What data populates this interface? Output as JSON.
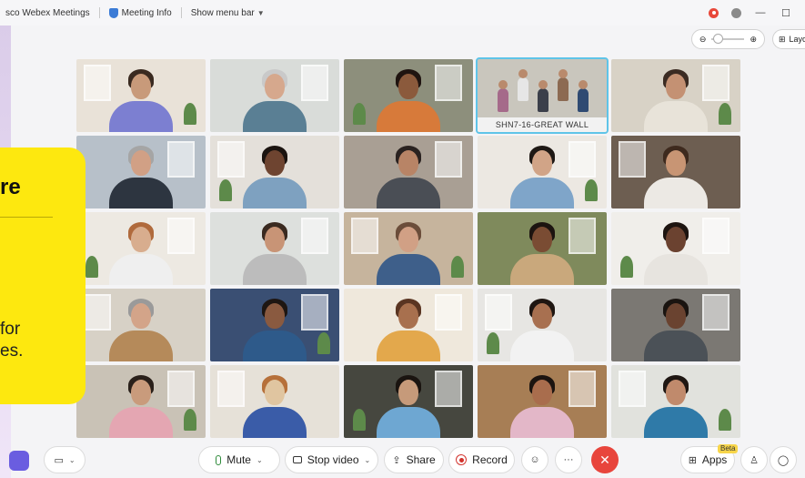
{
  "titlebar": {
    "app_title": "sco Webex Meetings",
    "meeting_info": "Meeting Info",
    "show_menu_bar": "Show menu bar"
  },
  "view": {
    "layout_label": "Layo"
  },
  "grid": {
    "tiles": [
      {
        "wall": "#e9e2d8",
        "skin": "#c89a7a",
        "hair": "#3a2a20",
        "shirt": "#7c7fd1"
      },
      {
        "wall": "#d9dcd9",
        "skin": "#d6a88d",
        "hair": "#c9c9c9",
        "shirt": "#5a7f94"
      },
      {
        "wall": "#8d8f7c",
        "skin": "#8b5a3c",
        "hair": "#1f1410",
        "shirt": "#d77a3a"
      },
      {
        "wall": "#c9c6bd",
        "room": true,
        "label": "SHN7-16-GREAT WALL"
      },
      {
        "wall": "#d8d2c6",
        "skin": "#c49173",
        "hair": "#3b2b22",
        "shirt": "#e8e3d9"
      },
      {
        "wall": "#b7c0c9",
        "skin": "#d1a085",
        "hair": "#a5a5a5",
        "shirt": "#2d3540"
      },
      {
        "wall": "#e4e0da",
        "skin": "#6e4430",
        "hair": "#1b1410",
        "shirt": "#7ea1c0"
      },
      {
        "wall": "#a99f94",
        "skin": "#b88466",
        "hair": "#2a2220",
        "shirt": "#4a4e55"
      },
      {
        "wall": "#ece8e2",
        "skin": "#d1a487",
        "hair": "#1e1814",
        "shirt": "#7fa5c9"
      },
      {
        "wall": "#6d5e51",
        "skin": "#c89574",
        "hair": "#3e2a1e",
        "shirt": "#ece9e4"
      },
      {
        "wall": "#ede9e2",
        "skin": "#d8ad8e",
        "hair": "#b06a3c",
        "shirt": "#efefef"
      },
      {
        "wall": "#dde0dd",
        "skin": "#c89476",
        "hair": "#3a2a20",
        "shirt": "#bcbcbc"
      },
      {
        "wall": "#c6b49d",
        "skin": "#d1a085",
        "hair": "#6b4d3a",
        "shirt": "#3e5f8a"
      },
      {
        "wall": "#7f8a5c",
        "skin": "#7a4c33",
        "hair": "#1c1410",
        "shirt": "#c9a87c"
      },
      {
        "wall": "#f0eeea",
        "skin": "#6b4230",
        "hair": "#1d1410",
        "shirt": "#e7e4df"
      },
      {
        "wall": "#d7d1c6",
        "skin": "#d3a489",
        "hair": "#9a9a9a",
        "shirt": "#b58a5a"
      },
      {
        "wall": "#3a4f73",
        "skin": "#8a5a40",
        "hair": "#1e1612",
        "shirt": "#2e5a8a"
      },
      {
        "wall": "#efe8dc",
        "skin": "#a8704e",
        "hair": "#5a3522",
        "shirt": "#e3a84c"
      },
      {
        "wall": "#e7e6e3",
        "skin": "#a87050",
        "hair": "#1f1612",
        "shirt": "#f2f2f2"
      },
      {
        "wall": "#7b7873",
        "skin": "#6a4330",
        "hair": "#1a1410",
        "shirt": "#4b5157"
      },
      {
        "wall": "#c9c2b6",
        "skin": "#c99b7c",
        "hair": "#2a201a",
        "shirt": "#e4a6b2"
      },
      {
        "wall": "#e6e1d8",
        "skin": "#e0c5a0",
        "hair": "#b6703a",
        "shirt": "#3a5ca8"
      },
      {
        "wall": "#46473f",
        "skin": "#c69a7a",
        "hair": "#1a1410",
        "shirt": "#6ea7d2"
      },
      {
        "wall": "#a77e55",
        "skin": "#a96d4d",
        "hair": "#1c1410",
        "shirt": "#e3b7c8"
      },
      {
        "wall": "#e1e2dd",
        "skin": "#c08a6c",
        "hair": "#1f1713",
        "shirt": "#2f7aa8"
      }
    ]
  },
  "promo": {
    "heading_fragment": "re",
    "line1": " for",
    "line2": "es."
  },
  "toolbar": {
    "mute_label": "Mute",
    "stop_video_label": "Stop video",
    "share_label": "Share",
    "record_label": "Record",
    "apps_label": "Apps",
    "beta_badge": "Beta",
    "more_label": "···"
  }
}
